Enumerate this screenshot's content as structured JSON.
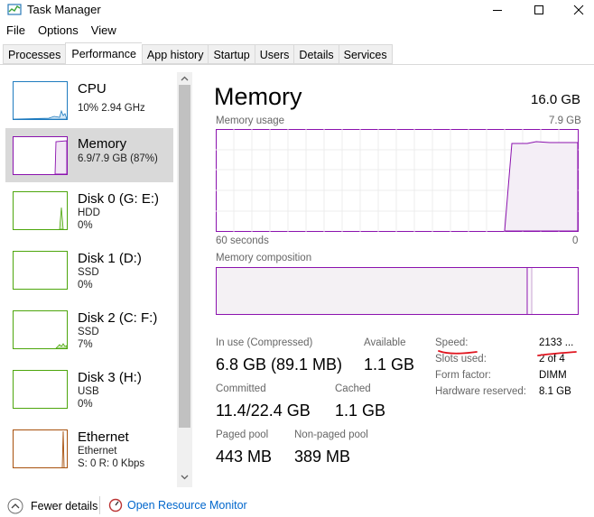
{
  "window": {
    "title": "Task Manager",
    "minimize_icon": "minimize-icon",
    "maximize_icon": "maximize-icon",
    "close_icon": "close-icon"
  },
  "menu": [
    "File",
    "Options",
    "View"
  ],
  "tabs": [
    "Processes",
    "Performance",
    "App history",
    "Startup",
    "Users",
    "Details",
    "Services"
  ],
  "active_tab": "Performance",
  "sidebar": [
    {
      "name": "CPU",
      "line1": "10%  2.94 GHz",
      "line2": "",
      "color": "#1f7bbf"
    },
    {
      "name": "Memory",
      "line1": "6.9/7.9 GB (87%)",
      "line2": "",
      "color": "#8b12ae"
    },
    {
      "name": "Disk 0 (G: E:)",
      "line1": "HDD",
      "line2": "0%",
      "color": "#4da60c"
    },
    {
      "name": "Disk 1 (D:)",
      "line1": "SSD",
      "line2": "0%",
      "color": "#4da60c"
    },
    {
      "name": "Disk 2 (C: F:)",
      "line1": "SSD",
      "line2": "7%",
      "color": "#4da60c"
    },
    {
      "name": "Disk 3 (H:)",
      "line1": "USB",
      "line2": "0%",
      "color": "#4da60c"
    },
    {
      "name": "Ethernet",
      "line1": "Ethernet",
      "line2": "S: 0  R: 0 Kbps",
      "color": "#a7500c"
    }
  ],
  "main": {
    "title": "Memory",
    "total": "16.0 GB",
    "usage_label": "Memory usage",
    "usage_max": "7.9 GB",
    "time_left": "60 seconds",
    "time_right": "0",
    "composition_label": "Memory composition",
    "stats": {
      "in_use_label": "In use (Compressed)",
      "in_use_value": "6.8 GB (89.1 MB)",
      "available_label": "Available",
      "available_value": "1.1 GB",
      "committed_label": "Committed",
      "committed_value": "11.4/22.4 GB",
      "cached_label": "Cached",
      "cached_value": "1.1 GB",
      "paged_label": "Paged pool",
      "paged_value": "443 MB",
      "nonpaged_label": "Non-paged pool",
      "nonpaged_value": "389 MB"
    },
    "details": [
      {
        "label": "Speed:",
        "value": "2133 ..."
      },
      {
        "label": "Slots used:",
        "value": "2 of 4"
      },
      {
        "label": "Form factor:",
        "value": "DIMM"
      },
      {
        "label": "Hardware reserved:",
        "value": "8.1 GB"
      }
    ]
  },
  "footer": {
    "fewer_details": "Fewer details",
    "open_resource_monitor": "Open Resource Monitor"
  },
  "colors": {
    "memory_accent": "#8b12ae",
    "memory_fill": "#f4f2f4",
    "annotation": "#e0141e"
  }
}
